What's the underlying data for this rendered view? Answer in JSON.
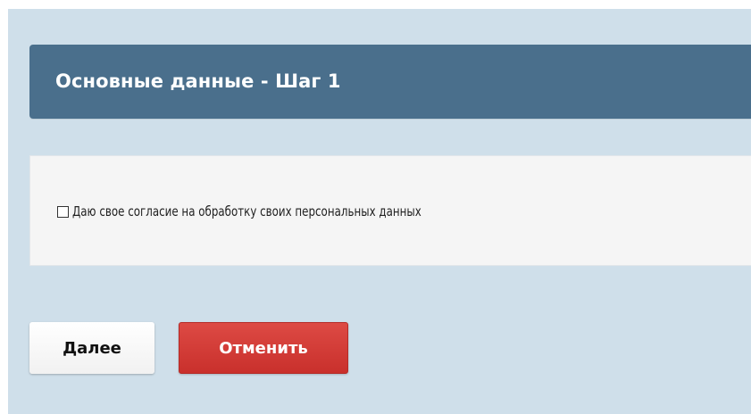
{
  "header": {
    "title": "Основные данные - Шаг 1"
  },
  "form": {
    "consent_checkbox": {
      "checked": false,
      "label": "Даю свое согласие на обработку своих персональных данных"
    }
  },
  "actions": {
    "next_label": "Далее",
    "cancel_label": "Отменить"
  },
  "colors": {
    "page_background": "#cfdfea",
    "header_background": "#4a6f8c",
    "panel_background": "#f5f5f5",
    "cancel_button": "#c9302c"
  }
}
